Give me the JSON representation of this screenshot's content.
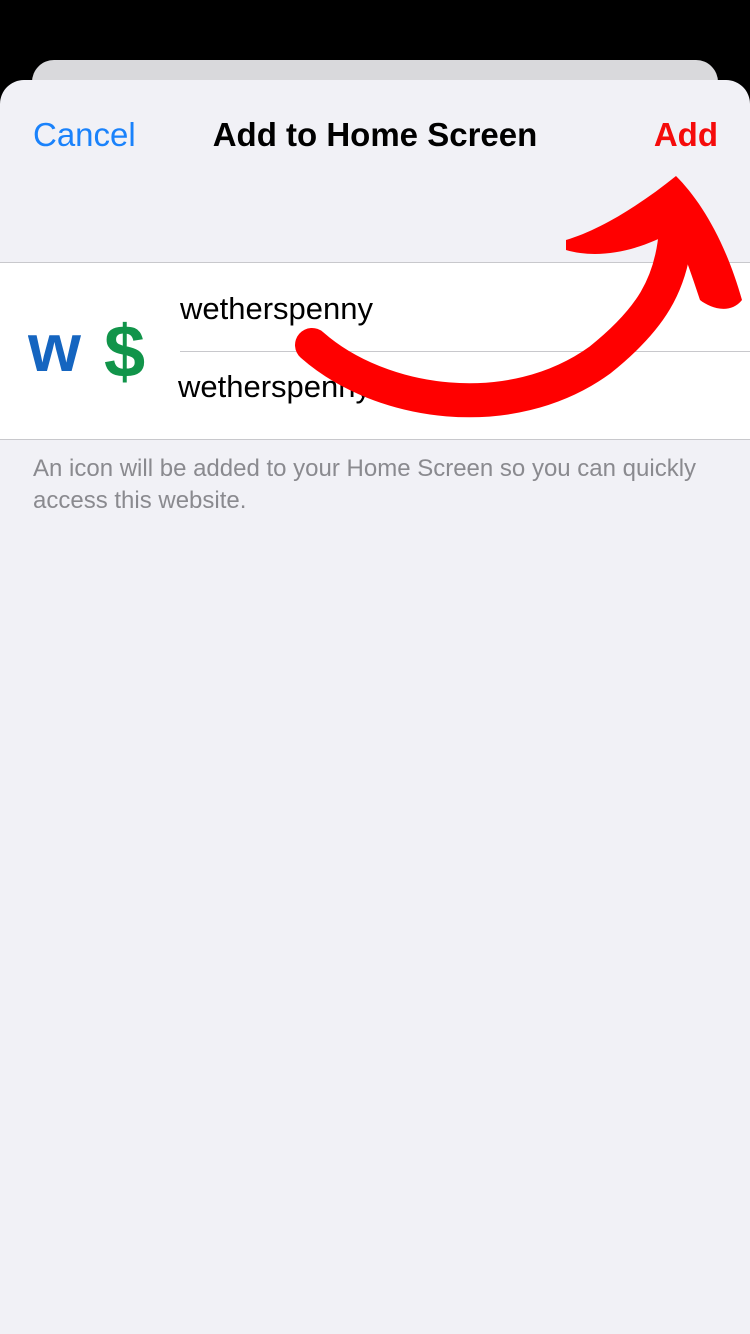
{
  "nav": {
    "cancel_label": "Cancel",
    "title": "Add to Home Screen",
    "add_label": "Add"
  },
  "shortcut": {
    "icon_text_w": "w",
    "icon_text_dollar": "$",
    "name_value": "wetherspenny",
    "url_text": "wetherspenny"
  },
  "footnote": "An icon will be added to your Home Screen so you can quickly access this website.",
  "colors": {
    "accent_blue": "#1a82fb",
    "add_red": "#f50b0b",
    "icon_blue": "#1565c0",
    "icon_green": "#11944a",
    "annotation_arrow": "#ff0000"
  },
  "annotation": {
    "type": "hand-drawn-arrow",
    "points_to": "add-button"
  }
}
